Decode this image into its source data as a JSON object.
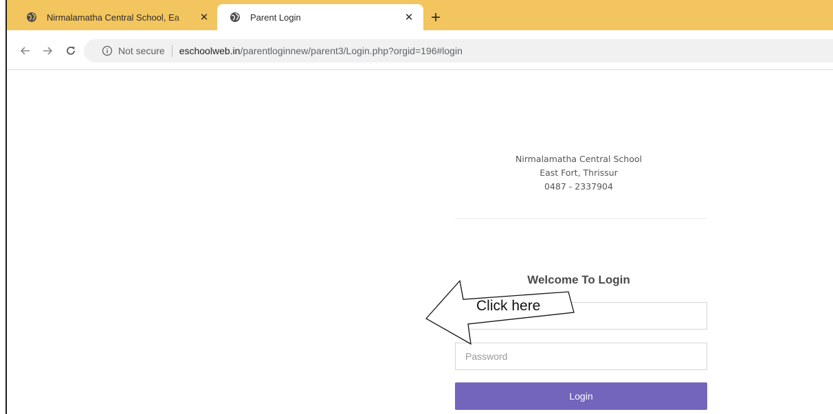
{
  "browser": {
    "tabs": [
      {
        "title": "Nirmalamatha Central School, Ea",
        "active": false,
        "close": "✕"
      },
      {
        "title": "Parent Login",
        "active": true,
        "close": "✕"
      }
    ],
    "new_tab": "+",
    "address_bar": {
      "security_label": "Not secure",
      "url_domain": "eschoolweb.in",
      "url_path": "/parentloginnew/parent3/Login.php?orgid=196#login"
    },
    "colors": {
      "tabstrip": "#f3c55e",
      "omnibox": "#f1f1f1"
    }
  },
  "page": {
    "school": {
      "name": "Nirmalamatha Central School",
      "address": "East Fort, Thrissur",
      "phone": "0487 - 2337904"
    },
    "login": {
      "heading": "Welcome To Login",
      "username_value": "",
      "password_placeholder": "Password",
      "button_label": "Login",
      "button_color": "#7365bb"
    }
  },
  "annotation": {
    "text": "Click here",
    "shape": "left-pointing-arrow"
  }
}
